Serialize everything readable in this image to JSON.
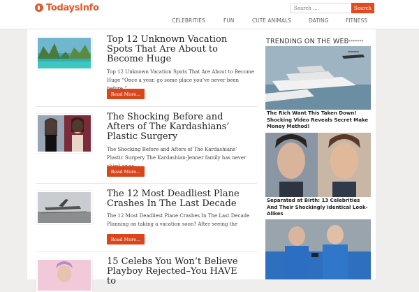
{
  "header": {
    "logo_text": "TodaysInfo",
    "search_placeholder": "Search ...",
    "search_button": "Search",
    "nav": [
      "CELEBRITIES",
      "FUN",
      "CUTE ANIMALS",
      "DATING",
      "FITNESS"
    ]
  },
  "articles": [
    {
      "title": "Top 12 Unknown Vacation Spots That Are About to Become Huge",
      "excerpt": "Top 12 Unknown Vacation Spots That Are About to Become Huge “Once a year, go some place you’ve never been before.”",
      "read_more": "Read More..."
    },
    {
      "title": "The Shocking Before and Afters of The Kardashians’ Plastic Surgery",
      "excerpt": "The Shocking Before and Afters of The Kardashians’ Plastic Surgery The Kardashian-Jenner family has never shied away",
      "read_more": "Read More..."
    },
    {
      "title": "The 12 Most Deadliest Plane Crashes In The Last Decade",
      "excerpt": "The 12 Most Deadliest Plane Crashes In The Last Decade Planning on taking a vacation soon? After seeing the",
      "read_more": "Read More..."
    },
    {
      "title": "15 Celebs You Won’t Believe Playboy Rejected–You HAVE to",
      "excerpt": "",
      "read_more": ""
    }
  ],
  "sidebar": {
    "title": "TRENDING ON THE WEB",
    "items": [
      {
        "caption": "The Rich Want This Taken Down! Shocking Video Reveals Secret Make Money Method!"
      },
      {
        "caption": "Separated at Birth: 13 Celebrities And Their Shockingly Identical Look-Alikes"
      },
      {
        "caption": ""
      }
    ]
  }
}
